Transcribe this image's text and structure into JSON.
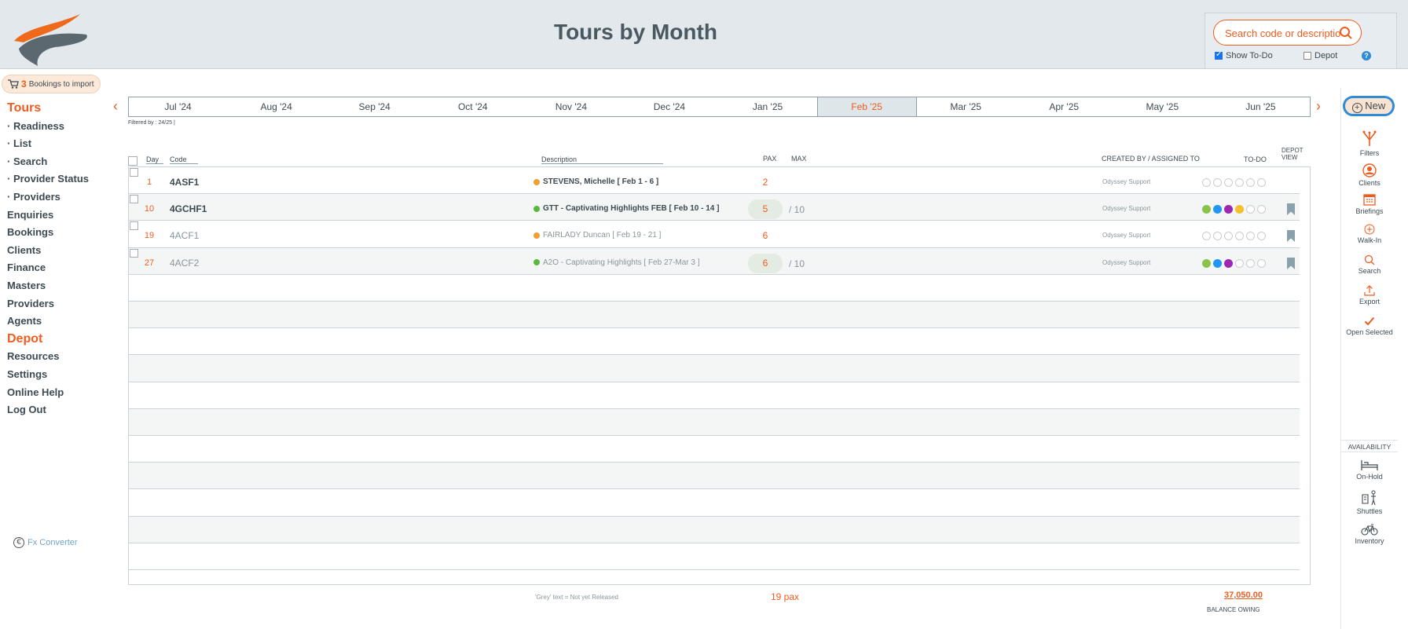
{
  "header": {
    "title": "Tours by Month"
  },
  "search": {
    "placeholder": "Search code or description ...",
    "show_todo_label": "Show To-Do",
    "depot_label": "Depot",
    "show_todo_checked": true,
    "depot_checked": false
  },
  "import": {
    "count": "3",
    "label": "Bookings to import"
  },
  "nav": {
    "items": [
      {
        "label": "Tours",
        "active": true
      },
      {
        "label": "· Readiness",
        "sub": true
      },
      {
        "label": "· List",
        "sub": true
      },
      {
        "label": "· Search",
        "sub": true
      },
      {
        "label": "· Provider Status",
        "sub": true
      },
      {
        "label": "· Providers",
        "sub": true
      },
      {
        "label": "Enquiries"
      },
      {
        "label": "Bookings"
      },
      {
        "label": "Clients"
      },
      {
        "label": "Finance"
      },
      {
        "label": "Masters"
      },
      {
        "label": "Providers"
      },
      {
        "label": "Agents"
      },
      {
        "label": "Depot",
        "active": true
      },
      {
        "label": "Resources"
      },
      {
        "label": "Settings"
      },
      {
        "label": "Online Help"
      },
      {
        "label": "Log Out"
      }
    ],
    "fx_converter": "Fx Converter"
  },
  "months": [
    "Jul '24",
    "Aug '24",
    "Sep '24",
    "Oct '24",
    "Nov '24",
    "Dec '24",
    "Jan '25",
    "Feb '25",
    "Mar '25",
    "Apr '25",
    "May '25",
    "Jun '25"
  ],
  "active_month": "Feb '25",
  "filtered_by": "Filtered by : 24/25 |",
  "table": {
    "columns": {
      "day": "Day",
      "code": "Code",
      "description": "Description",
      "pax": "PAX",
      "max": "MAX",
      "created": "CREATED BY / ASSIGNED TO",
      "todo": "TO-DO",
      "depot_view": "DEPOT VIEW"
    },
    "rows": [
      {
        "day": "1",
        "code": "4ASF1",
        "description": "STEVENS, Michelle  [ Feb 1 - 6 ]",
        "dot": "#f0a030",
        "pax": "2",
        "max": "",
        "owner": "Odyssey Support",
        "todo": [
          "",
          "",
          "",
          "",
          "",
          ""
        ],
        "grey": false,
        "bookmark": false,
        "pax_pill": false
      },
      {
        "day": "10",
        "code": "4GCHF1",
        "description": "GTT - Captivating Highlights FEB  [ Feb 10 - 14 ]",
        "dot": "#5cb83c",
        "pax": "5",
        "max": "/ 10",
        "owner": "Odyssey Support",
        "todo": [
          "#8bc34a",
          "#2196f3",
          "#9c27b0",
          "#f4c030",
          "",
          ""
        ],
        "grey": false,
        "bookmark": true,
        "pax_pill": true
      },
      {
        "day": "19",
        "code": "4ACF1",
        "description": "FAIRLADY Duncan  [ Feb 19 - 21 ]",
        "dot": "#f0a030",
        "pax": "6",
        "max": "",
        "owner": "Odyssey Support",
        "todo": [
          "",
          "",
          "",
          "",
          "",
          ""
        ],
        "grey": true,
        "bookmark": true,
        "pax_pill": false
      },
      {
        "day": "27",
        "code": "4ACF2",
        "description": "A2O - Captivating Highlights  [ Feb 27-Mar 3 ]",
        "dot": "#5cb83c",
        "pax": "6",
        "max": "/ 10",
        "owner": "Odyssey Support",
        "todo": [
          "#8bc34a",
          "#2196f3",
          "#9c27b0",
          "",
          "",
          ""
        ],
        "grey": true,
        "bookmark": true,
        "pax_pill": true
      }
    ]
  },
  "toolbar": {
    "new_label": "New",
    "tools": [
      "Filters",
      "Clients",
      "Briefings",
      "Walk-In",
      "Search",
      "Export",
      "Open Selected"
    ],
    "availability_label": "AVAILABILITY",
    "avail_tools": [
      "On-Hold",
      "Shuttles",
      "Inventory"
    ]
  },
  "footer": {
    "note": "'Grey' text = Not yet Released",
    "total_pax": "19 pax",
    "balance": "37,050.00",
    "balance_label": "BALANCE OWING"
  },
  "colors": {
    "accent": "#ee5c1f",
    "header_bg": "#e2e8ec",
    "text": "#3d4a52"
  }
}
